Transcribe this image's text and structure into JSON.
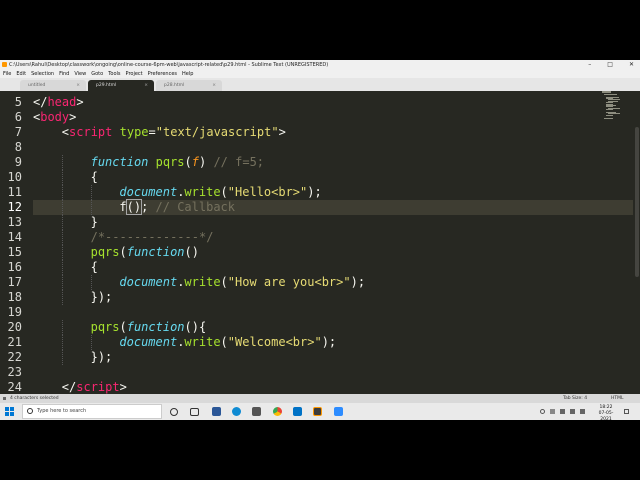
{
  "window": {
    "title": "C:\\Users\\Rahul\\Desktop\\classwork\\ongoing\\online-course-6pm-web\\javascript-related\\p29.html - Sublime Text (UNREGISTERED)",
    "controls": {
      "minimize": "–",
      "maximize": "□",
      "close": "✕"
    }
  },
  "menu": [
    "File",
    "Edit",
    "Selection",
    "Find",
    "View",
    "Goto",
    "Tools",
    "Project",
    "Preferences",
    "Help"
  ],
  "tabs": [
    {
      "label": "untitled",
      "close": "×",
      "active": false
    },
    {
      "label": "p29.html",
      "close": "×",
      "active": true
    },
    {
      "label": "p28.html",
      "close": "×",
      "active": false
    }
  ],
  "editor": {
    "current_line": 12,
    "lines": [
      {
        "n": "5",
        "indent": 0,
        "parts": [
          [
            "punc",
            "</"
          ],
          [
            "tag",
            "head"
          ],
          [
            "punc",
            ">"
          ]
        ]
      },
      {
        "n": "6",
        "indent": 0,
        "parts": [
          [
            "punc",
            "<"
          ],
          [
            "tag",
            "body"
          ],
          [
            "punc",
            ">"
          ]
        ]
      },
      {
        "n": "7",
        "indent": 1,
        "parts": [
          [
            "punc",
            "<"
          ],
          [
            "tag",
            "script"
          ],
          [
            "punc",
            " "
          ],
          [
            "attr",
            "type"
          ],
          [
            "punc",
            "="
          ],
          [
            "str",
            "\"text/javascript\""
          ],
          [
            "punc",
            ">"
          ]
        ]
      },
      {
        "n": "8",
        "indent": 0,
        "parts": []
      },
      {
        "n": "9",
        "indent": 2,
        "parts": [
          [
            "kw",
            "function"
          ],
          [
            "punc",
            " "
          ],
          [
            "fn",
            "pqrs"
          ],
          [
            "punc",
            "("
          ],
          [
            "param",
            "f"
          ],
          [
            "punc",
            ") "
          ],
          [
            "cmt",
            "// f=5;"
          ]
        ]
      },
      {
        "n": "10",
        "indent": 2,
        "parts": [
          [
            "punc",
            "{"
          ]
        ]
      },
      {
        "n": "11",
        "indent": 3,
        "parts": [
          [
            "obj",
            "document"
          ],
          [
            "punc",
            "."
          ],
          [
            "fn",
            "write"
          ],
          [
            "punc",
            "("
          ],
          [
            "str",
            "\"Hello<br>\""
          ],
          [
            "punc",
            ");"
          ]
        ]
      },
      {
        "n": "12",
        "indent": 3,
        "parts": [
          [
            "punc",
            "f"
          ],
          [
            "bracket",
            "()"
          ],
          [
            "punc",
            "; "
          ],
          [
            "cmt",
            "// Callback"
          ]
        ]
      },
      {
        "n": "13",
        "indent": 2,
        "parts": [
          [
            "punc",
            "}"
          ]
        ]
      },
      {
        "n": "14",
        "indent": 2,
        "parts": [
          [
            "cmt",
            "/*-------------*/"
          ]
        ]
      },
      {
        "n": "15",
        "indent": 2,
        "parts": [
          [
            "fn",
            "pqrs"
          ],
          [
            "punc",
            "("
          ],
          [
            "kw",
            "function"
          ],
          [
            "punc",
            "()"
          ]
        ]
      },
      {
        "n": "16",
        "indent": 2,
        "parts": [
          [
            "punc",
            "{"
          ]
        ]
      },
      {
        "n": "17",
        "indent": 3,
        "parts": [
          [
            "obj",
            "document"
          ],
          [
            "punc",
            "."
          ],
          [
            "fn",
            "write"
          ],
          [
            "punc",
            "("
          ],
          [
            "str",
            "\"How are you<br>\""
          ],
          [
            "punc",
            ");"
          ]
        ]
      },
      {
        "n": "18",
        "indent": 2,
        "parts": [
          [
            "punc",
            "});"
          ]
        ]
      },
      {
        "n": "19",
        "indent": 0,
        "parts": []
      },
      {
        "n": "20",
        "indent": 2,
        "parts": [
          [
            "fn",
            "pqrs"
          ],
          [
            "punc",
            "("
          ],
          [
            "kw",
            "function"
          ],
          [
            "punc",
            "(){"
          ]
        ]
      },
      {
        "n": "21",
        "indent": 3,
        "parts": [
          [
            "obj",
            "document"
          ],
          [
            "punc",
            "."
          ],
          [
            "fn",
            "write"
          ],
          [
            "punc",
            "("
          ],
          [
            "str",
            "\"Welcome<br>\""
          ],
          [
            "punc",
            ");"
          ]
        ]
      },
      {
        "n": "22",
        "indent": 2,
        "parts": [
          [
            "punc",
            "});"
          ]
        ]
      },
      {
        "n": "23",
        "indent": 0,
        "parts": []
      },
      {
        "n": "24",
        "indent": 1,
        "parts": [
          [
            "punc",
            "</"
          ],
          [
            "tag",
            "script"
          ],
          [
            "punc",
            ">"
          ]
        ]
      }
    ]
  },
  "status": {
    "left": "4 characters selected",
    "tab_size": "Tab Size: 4",
    "syntax": "HTML"
  },
  "taskbar": {
    "search_placeholder": "Type here to search",
    "time": "18:22",
    "date": "07-05-2021"
  },
  "colors": {
    "editor_bg": "#272822",
    "keyword": "#66d9ef",
    "tag": "#f92672",
    "string": "#e6db74",
    "function": "#a6e22e",
    "comment": "#75715e"
  }
}
